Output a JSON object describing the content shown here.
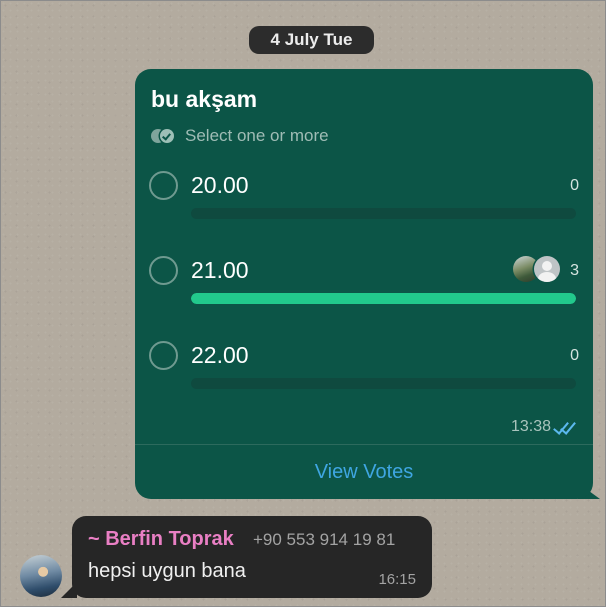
{
  "date_separator": "4 July Tue",
  "poll": {
    "title": "bu akşam",
    "subtitle": "Select one or more",
    "options": [
      {
        "label": "20.00",
        "votes": "0",
        "fill_fraction": 0.0
      },
      {
        "label": "21.00",
        "votes": "3",
        "fill_fraction": 1.0,
        "voter_avatars": [
          "photo-avatar",
          "default-person-avatar"
        ]
      },
      {
        "label": "22.00",
        "votes": "0",
        "fill_fraction": 0.0
      }
    ],
    "time": "13:38",
    "status_icon": "double-check-read-icon",
    "view_votes_label": "View Votes"
  },
  "received_message": {
    "sender_name": "~ Berfin Toprak",
    "sender_phone": "+90 553 914 19 81",
    "text": "hepsi uygun bana",
    "time": "16:15"
  },
  "colors": {
    "poll_bubble": "#0c5547",
    "bar_fill": "#22c98c",
    "link": "#3fa6e2",
    "sender_name": "#e97fc4",
    "received_bubble": "#262626",
    "read_ticks": "#5cb8ee"
  }
}
